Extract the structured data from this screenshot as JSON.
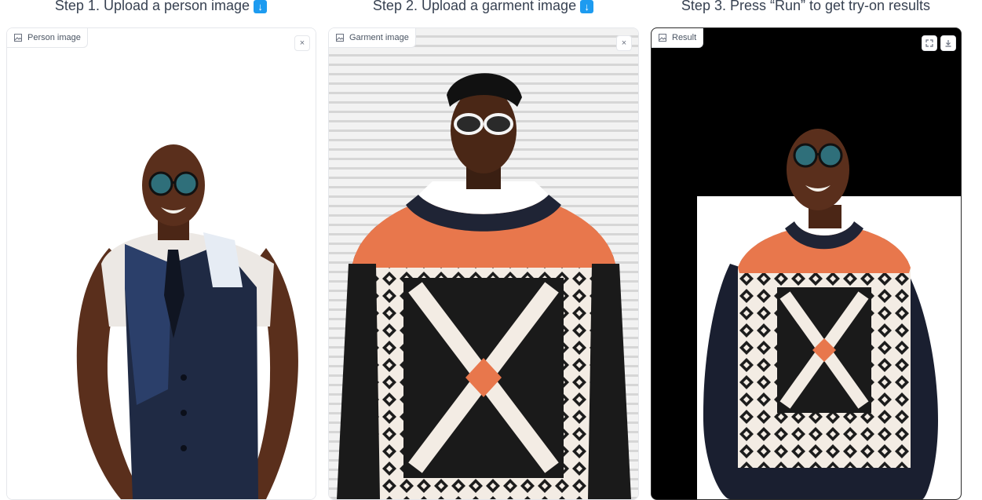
{
  "steps": [
    {
      "title": "Step 1. Upload a person image",
      "arrow_icon": "down-arrow-icon"
    },
    {
      "title": "Step 2. Upload a garment image",
      "arrow_icon": "down-arrow-icon"
    },
    {
      "title": "Step 3. Press “Run” to get try-on results"
    }
  ],
  "panels": {
    "person": {
      "label": "Person image",
      "icon": "image-icon",
      "action_icon": "close-icon"
    },
    "garment": {
      "label": "Garment image",
      "icon": "image-icon",
      "action_icon": "close-icon"
    },
    "result": {
      "label": "Result",
      "icon": "image-icon",
      "action_icons": [
        "fullscreen-icon",
        "download-icon"
      ]
    }
  },
  "colors": {
    "step_arrow": "#1d9bf0",
    "result_background": "#000000",
    "sweater_orange": "#e8774c",
    "sweater_navy": "#1f2435"
  },
  "symbols": {
    "arrow": "↓",
    "close": "×"
  }
}
